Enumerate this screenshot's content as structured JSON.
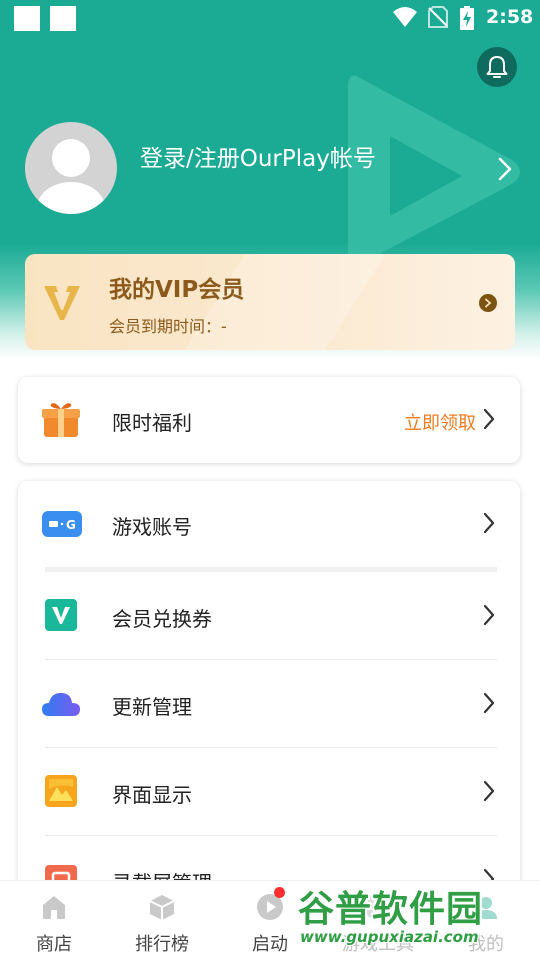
{
  "status_bar": {
    "time": "2:58"
  },
  "profile": {
    "login_text": "登录/注册OurPlay帐号"
  },
  "vip": {
    "title": "我的VIP会员",
    "expiry": "会员到期时间：-"
  },
  "welfare": {
    "label": "限时福利",
    "action": "立即领取"
  },
  "menu": {
    "items": [
      {
        "label": "游戏账号",
        "icon": "game-account-icon"
      },
      {
        "label": "会员兑换券",
        "icon": "voucher-icon"
      },
      {
        "label": "更新管理",
        "icon": "cloud-update-icon"
      },
      {
        "label": "界面显示",
        "icon": "display-icon"
      },
      {
        "label": "录载屏管理",
        "icon": "screen-record-icon"
      }
    ]
  },
  "bottom_nav": {
    "items": [
      {
        "label": "商店",
        "icon": "store-icon"
      },
      {
        "label": "排行榜",
        "icon": "ranking-icon"
      },
      {
        "label": "启动",
        "icon": "launch-icon"
      },
      {
        "label": "游戏工具",
        "icon": "tools-icon"
      },
      {
        "label": "我的",
        "icon": "profile-icon"
      }
    ]
  },
  "watermark": {
    "title": "谷普软件园",
    "url": "www.gupuxiazai.com"
  },
  "colors": {
    "header": "#1bab95",
    "accent_orange": "#f07a1e",
    "vip_text": "#8b5a1c",
    "notification_dot": "#ff2e2e"
  }
}
